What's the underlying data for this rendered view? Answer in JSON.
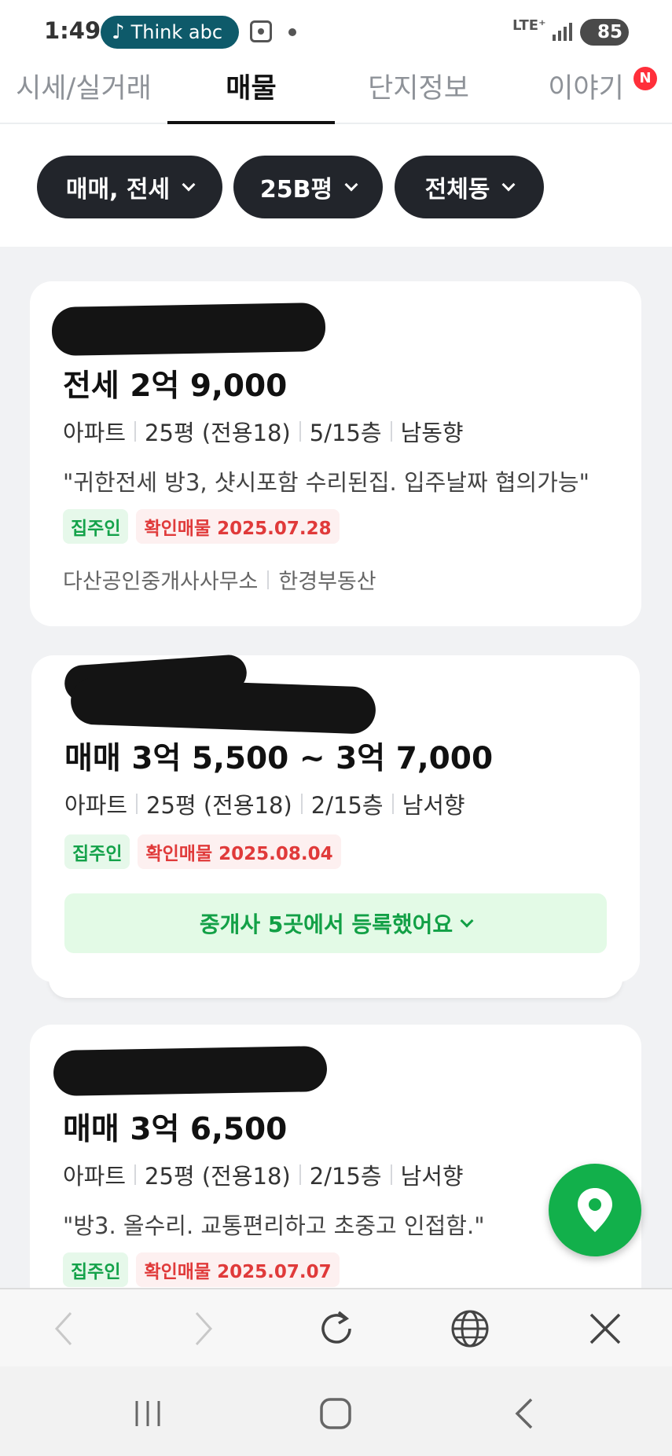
{
  "status_bar": {
    "time": "1:49",
    "media_text": "Think abc",
    "network": "LTE⁺",
    "battery": "85"
  },
  "tabs": [
    {
      "label": "시세/실거래"
    },
    {
      "label": "매물"
    },
    {
      "label": "단지정보"
    },
    {
      "label": "이야기",
      "badge": "N"
    }
  ],
  "filters": [
    {
      "label": "매매, 전세"
    },
    {
      "label": "25B평"
    },
    {
      "label": "전체동"
    }
  ],
  "listings": [
    {
      "price": "전세 2억 9,000",
      "meta": [
        "아파트",
        "25평 (전용18)",
        "5/15층",
        "남동향"
      ],
      "description": "\"귀한전세 방3, 샷시포함 수리된집. 입주날짜 협의가능\"",
      "owner_tag": "집주인",
      "confirm_tag": "확인매물 2025.07.28",
      "agencies": [
        "다산공인중개사사무소",
        "한경부동산"
      ]
    },
    {
      "price": "매매 3억 5,500 ~ 3억 7,000",
      "meta": [
        "아파트",
        "25평 (전용18)",
        "2/15층",
        "남서향"
      ],
      "owner_tag": "집주인",
      "confirm_tag": "확인매물 2025.08.04",
      "broker_note": "중개사 5곳에서 등록했어요"
    },
    {
      "price": "매매 3억 6,500",
      "meta": [
        "아파트",
        "25평 (전용18)",
        "2/15층",
        "남서향"
      ],
      "description": "\"방3. 올수리. 교통편리하고 초중고 인접함.\"",
      "owner_tag": "집주인",
      "confirm_tag": "확인매물 2025.07.07"
    }
  ],
  "colors": {
    "accent_green": "#12b04b",
    "chip_dark": "#22252b",
    "confirm_red": "#e03a3a",
    "badge_red": "#ff2f3a"
  }
}
